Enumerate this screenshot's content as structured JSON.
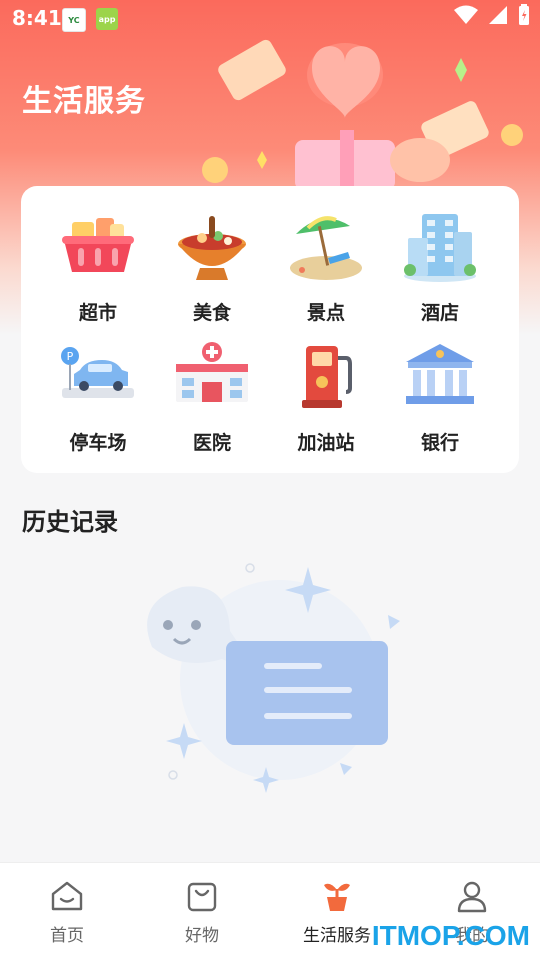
{
  "status_bar": {
    "time": "8:41",
    "notif_a": "YC",
    "notif_b": "app"
  },
  "header": {
    "title": "生活服务"
  },
  "services": [
    {
      "label": "超市",
      "icon": "shopping-basket-icon"
    },
    {
      "label": "美食",
      "icon": "hotpot-icon"
    },
    {
      "label": "景点",
      "icon": "beach-umbrella-icon"
    },
    {
      "label": "酒店",
      "icon": "hotel-building-icon"
    },
    {
      "label": "停车场",
      "icon": "parking-car-icon"
    },
    {
      "label": "医院",
      "icon": "hospital-icon"
    },
    {
      "label": "加油站",
      "icon": "gas-pump-icon"
    },
    {
      "label": "银行",
      "icon": "bank-icon"
    }
  ],
  "history": {
    "title": "历史记录"
  },
  "tabs": [
    {
      "label": "首页",
      "icon": "home-icon",
      "active": false
    },
    {
      "label": "好物",
      "icon": "shopping-bag-icon",
      "active": false
    },
    {
      "label": "生活服务",
      "icon": "sprout-icon",
      "active": true
    },
    {
      "label": "我的",
      "icon": "user-icon",
      "active": false
    }
  ],
  "watermark": "ITMOP.COM",
  "colors": {
    "accent": "#fb6a5c",
    "tab_active": "#f26a3d",
    "watermark": "#1aa3e8"
  }
}
